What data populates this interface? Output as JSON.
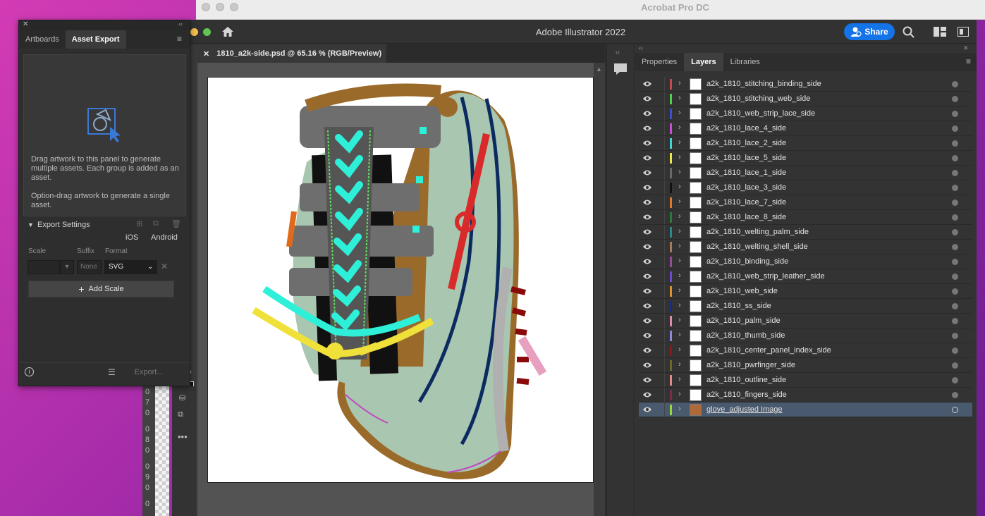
{
  "acrobat": {
    "title": "Acrobat Pro DC"
  },
  "app": {
    "title": "Adobe Illustrator 2022",
    "share_label": "Share"
  },
  "document": {
    "tab_title": "1810_a2k-side.psd @ 65.16 % (RGB/Preview)"
  },
  "asset_export": {
    "tabs": [
      "Artboards",
      "Asset Export"
    ],
    "description_1": "Drag artwork to this panel to generate multiple assets. Each group is added as an asset.",
    "description_2": "Option-drag artwork to generate a single asset.",
    "export_settings_label": "Export Settings",
    "platform_ios": "iOS",
    "platform_android": "Android",
    "scale_label": "Scale",
    "suffix_label": "Suffix",
    "format_label": "Format",
    "suffix_placeholder": "None",
    "format_value": "SVG",
    "add_scale_label": "Add Scale",
    "export_button": "Export..."
  },
  "right_panel": {
    "tabs": [
      "Properties",
      "Layers",
      "Libraries"
    ],
    "active_tab": "Layers"
  },
  "layers": [
    {
      "name": "a2k_1810_stitching_binding_side",
      "color": "#c94a4a"
    },
    {
      "name": "a2k_1810_stitching_web_side",
      "color": "#4fd14f"
    },
    {
      "name": "a2k_1810_web_strip_lace_side",
      "color": "#3b4fd6"
    },
    {
      "name": "a2k_1810_lace_4_side",
      "color": "#c94fd6"
    },
    {
      "name": "a2k_1810_lace_2_side",
      "color": "#3fd6d6"
    },
    {
      "name": "a2k_1810_lace_5_side",
      "color": "#e8e84a"
    },
    {
      "name": "a2k_1810_lace_1_side",
      "color": "#6a6a6a"
    },
    {
      "name": "a2k_1810_lace_3_side",
      "color": "#111111"
    },
    {
      "name": "a2k_1810_lace_7_side",
      "color": "#e07a2a"
    },
    {
      "name": "a2k_1810_lace_8_side",
      "color": "#2a7a3a"
    },
    {
      "name": "a2k_1810_welting_palm_side",
      "color": "#2a8a8a"
    },
    {
      "name": "a2k_1810_welting_shell_side",
      "color": "#a87a5a"
    },
    {
      "name": "a2k_1810_binding_side",
      "color": "#9a4a9a"
    },
    {
      "name": "a2k_1810_web_strip_leather_side",
      "color": "#6a4ad6"
    },
    {
      "name": "a2k_1810_web_side",
      "color": "#e0902a"
    },
    {
      "name": "a2k_1810_ss_side",
      "color": "#1a2a8a"
    },
    {
      "name": "a2k_1810_palm_side",
      "color": "#e08ab0"
    },
    {
      "name": "a2k_1810_thumb_side",
      "color": "#8a8ad6"
    },
    {
      "name": "a2k_1810_center_panel_index_side",
      "color": "#8a1a1a"
    },
    {
      "name": "a2k_1810_pwrfinger_side",
      "color": "#6a6a2a"
    },
    {
      "name": "a2k_1810_outline_side",
      "color": "#e08a8a"
    },
    {
      "name": "a2k_1810_fingers_side",
      "color": "#7a2a4a"
    },
    {
      "name": "glove_adjusted Image",
      "color": "#9ad63a",
      "selected": true
    }
  ],
  "ruler": [
    "0",
    "7",
    "0",
    "0",
    "8",
    "0",
    "0",
    "9",
    "0",
    "0"
  ]
}
